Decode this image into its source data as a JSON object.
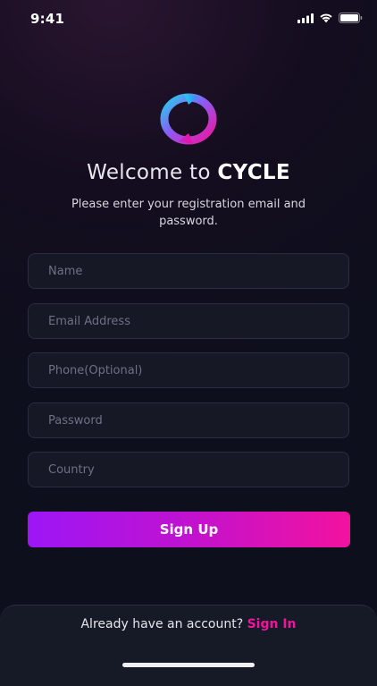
{
  "status_bar": {
    "time": "9:41"
  },
  "header": {
    "title_prefix": "Welcome to ",
    "brand": "CYCLE",
    "subtitle": "Please enter your registration email and password."
  },
  "form": {
    "name_placeholder": "Name",
    "email_placeholder": "Email Address",
    "phone_placeholder": "Phone(Optional)",
    "password_placeholder": "Password",
    "country_placeholder": "Country",
    "submit_label": "Sign Up"
  },
  "footer": {
    "prompt": "Already have an account? ",
    "signin_label": "Sign In"
  },
  "colors": {
    "accent_pink": "#f0149e",
    "accent_purple": "#9d16f6",
    "logo_cyan": "#22d3ee"
  }
}
